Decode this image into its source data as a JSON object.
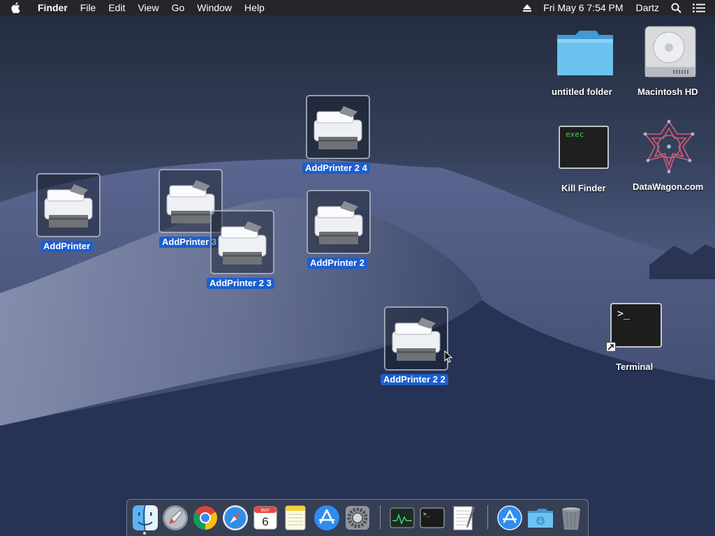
{
  "menubar": {
    "app_name": "Finder",
    "items": [
      "File",
      "Edit",
      "View",
      "Go",
      "Window",
      "Help"
    ],
    "clock": "Fri May 6  7:54 PM",
    "user": "Dartz"
  },
  "desktop": {
    "icons": [
      {
        "label": "AddPrinter",
        "type": "printer",
        "selected": true
      },
      {
        "label": "AddPrinter 3",
        "type": "printer",
        "selected": true
      },
      {
        "label": "AddPrinter 2 3",
        "type": "printer",
        "selected": true
      },
      {
        "label": "AddPrinter 2 4",
        "type": "printer",
        "selected": true
      },
      {
        "label": "AddPrinter 2",
        "type": "printer",
        "selected": true
      },
      {
        "label": "AddPrinter 2 2",
        "type": "printer",
        "selected": true
      },
      {
        "label": "untitled folder",
        "type": "folder",
        "selected": false
      },
      {
        "label": "Macintosh HD",
        "type": "hard-drive",
        "selected": false
      },
      {
        "label": "Kill Finder",
        "type": "exec",
        "selected": false,
        "thumb_text": "exec"
      },
      {
        "label": "DataWagon.com",
        "type": "webloc",
        "selected": false
      },
      {
        "label": "Terminal",
        "type": "terminal-alias",
        "selected": false,
        "thumb_text": ">_"
      }
    ]
  },
  "dock": {
    "items": [
      {
        "name": "Finder",
        "icon": "finder-icon",
        "running": true
      },
      {
        "name": "Launchpad",
        "icon": "launchpad-icon"
      },
      {
        "name": "Google Chrome",
        "icon": "chrome-icon"
      },
      {
        "name": "Safari",
        "icon": "safari-icon"
      },
      {
        "name": "Calendar",
        "icon": "calendar-icon",
        "month": "MAY",
        "day": "6"
      },
      {
        "name": "Notes",
        "icon": "notes-icon"
      },
      {
        "name": "App Store",
        "icon": "app-store-icon"
      },
      {
        "name": "System Preferences",
        "icon": "system-preferences-icon"
      },
      {
        "name": "Activity Monitor",
        "icon": "activity-monitor-icon"
      },
      {
        "name": "Terminal",
        "icon": "terminal-icon",
        "glyph": ">_"
      },
      {
        "name": "TextEdit",
        "icon": "textedit-icon"
      },
      {
        "name": "Applications",
        "icon": "applications-folder-icon"
      },
      {
        "name": "Downloads",
        "icon": "downloads-folder-icon"
      },
      {
        "name": "Trash",
        "icon": "trash-icon"
      }
    ]
  },
  "colors": {
    "selection": "#1b5fd0",
    "menubar": "#26262a",
    "folder": "#5bb8ea"
  }
}
